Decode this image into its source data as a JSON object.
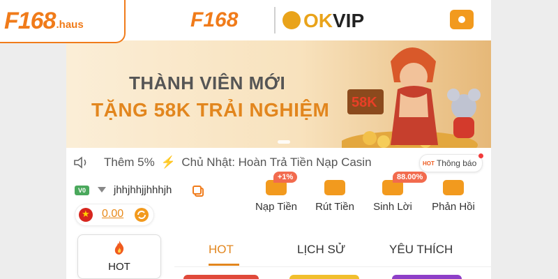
{
  "watermark": {
    "brand": "F168",
    "suffix": ".haus"
  },
  "header": {
    "logo_f168": "F168",
    "logo_ok": "OK",
    "logo_vip": "VIP",
    "gift_icon": "gift-icon"
  },
  "banner": {
    "line1": "THÀNH VIÊN MỚI",
    "line2": "TẶNG 58K TRẢI NGHIỆM",
    "badge": "58K"
  },
  "ticker": {
    "text1": "Thêm 5%",
    "text2": "Chủ Nhật: Hoàn Trả Tiền Nạp Casin",
    "notify_hot": "HOT",
    "notify_label": "Thông báo"
  },
  "account": {
    "vip_level": "V0",
    "username": "jhhjhhjjhhhjh",
    "balance": "0.00"
  },
  "actions": [
    {
      "label": "Nạp Tiền",
      "tag": "+1%"
    },
    {
      "label": "Rút Tiền",
      "tag": ""
    },
    {
      "label": "Sinh Lời",
      "tag": "88.00%"
    },
    {
      "label": "Phản Hồi",
      "tag": ""
    }
  ],
  "side_category": {
    "label": "HOT"
  },
  "tabs": [
    {
      "label": "HOT"
    },
    {
      "label": "LỊCH SỬ"
    },
    {
      "label": "YÊU THÍCH"
    }
  ],
  "colors": {
    "accent": "#f07b1a",
    "tab_active": "#e2861e",
    "tag": "#f26b4e",
    "vip": "#4aa85c"
  }
}
